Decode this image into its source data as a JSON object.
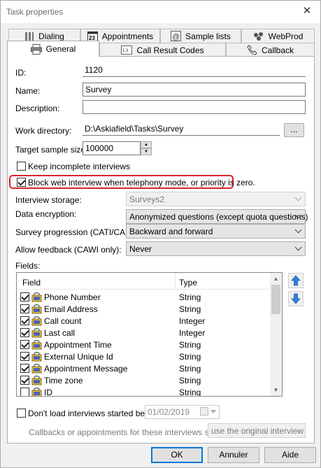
{
  "window": {
    "title": "Task properties"
  },
  "tabs_top": [
    {
      "label": "Dialing",
      "icon": "dialing-grid-icon"
    },
    {
      "label": "Appointments",
      "icon": "calendar-icon"
    },
    {
      "label": "Sample lists",
      "icon": "sample-list-icon"
    },
    {
      "label": "WebProd",
      "icon": "webprod-icon"
    }
  ],
  "tabs_bottom": [
    {
      "label": "General",
      "icon": "printer-icon",
      "active": true
    },
    {
      "label": "Call Result Codes",
      "icon": "codes-icon"
    },
    {
      "label": "Callback",
      "icon": "phone-handset-icon"
    }
  ],
  "general": {
    "id_label": "ID:",
    "id_value": "1120",
    "name_label": "Name:",
    "name_value": "Survey",
    "description_label": "Description:",
    "description_value": "",
    "workdir_label": "Work directory:",
    "workdir_value": "D:\\Askiafield\\Tasks\\Survey",
    "browse_label": "...",
    "target_label": "Target sample size:",
    "target_value": "100000",
    "keep_incomplete_label": "Keep incomplete interviews",
    "keep_incomplete_checked": false,
    "block_web_label": "Block web interview when telephony mode, or priority is zero.",
    "block_web_checked": true,
    "storage_label": "Interview storage:",
    "storage_value": "Surveys2",
    "encryption_label": "Data encryption:",
    "encryption_value": "Anonymized questions (except quota questions)",
    "progression_label": "Survey progression (CATI/CAPI):",
    "progression_value": "Backward and forward",
    "feedback_label": "Allow feedback (CAWI only):",
    "feedback_value": "Never",
    "fields_label": "Fields:"
  },
  "fields_table": {
    "col_field": "Field",
    "col_type": "Type",
    "rows": [
      {
        "name": "Phone Number",
        "type": "String",
        "checked": true
      },
      {
        "name": "Email Address",
        "type": "String",
        "checked": true
      },
      {
        "name": "Call count",
        "type": "Integer",
        "checked": true
      },
      {
        "name": "Last call",
        "type": "Integer",
        "checked": true
      },
      {
        "name": "Appointment Time",
        "type": "String",
        "checked": true
      },
      {
        "name": "External Unique Id",
        "type": "String",
        "checked": true
      },
      {
        "name": "Appointment Message",
        "type": "String",
        "checked": true
      },
      {
        "name": "Time zone",
        "type": "String",
        "checked": true
      },
      {
        "name": "ID",
        "type": "String",
        "checked": false
      }
    ]
  },
  "dont_load": {
    "label": "Don't load interviews started before",
    "checked": false,
    "date_value": "01/02/2019",
    "callbacks_label": "Callbacks or appointments for these interviews should",
    "callbacks_value": "use the original interview"
  },
  "footer": {
    "ok": "OK",
    "cancel": "Annuler",
    "help": "Aide"
  },
  "colors": {
    "highlight": "#d9232d",
    "accent": "#0078d7"
  }
}
